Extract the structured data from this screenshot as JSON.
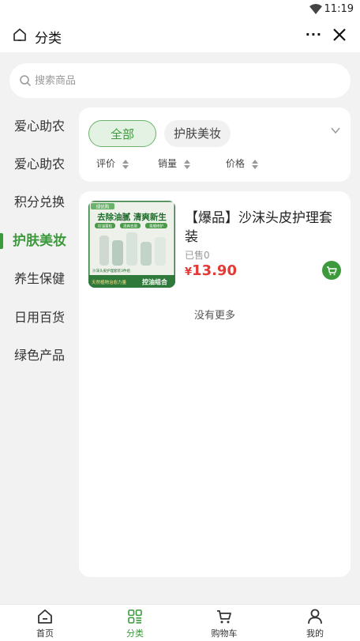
{
  "status_bar": {
    "time": "11:19",
    "wifi_icon": "wifi-icon"
  },
  "nav": {
    "title": "分类",
    "more_label": "···",
    "home_icon": "home-icon",
    "close_icon": "close-icon"
  },
  "search": {
    "placeholder": "搜索商品",
    "value": ""
  },
  "sidebar": {
    "items": [
      {
        "label": "爱心助农",
        "active": false
      },
      {
        "label": "爱心助农",
        "active": false
      },
      {
        "label": "积分兑换",
        "active": false
      },
      {
        "label": "护肤美妆",
        "active": true
      },
      {
        "label": "养生保健",
        "active": false
      },
      {
        "label": "日用百货",
        "active": false
      },
      {
        "label": "绿色产品",
        "active": false
      }
    ]
  },
  "filter": {
    "chips": [
      {
        "label": "全部",
        "active": true
      },
      {
        "label": "护肤美妆",
        "active": false
      }
    ],
    "sort": [
      {
        "label": "评价"
      },
      {
        "label": "销量"
      },
      {
        "label": "价格"
      }
    ]
  },
  "products": [
    {
      "name": "【爆品】沙沫头皮护理套装",
      "sold": "已售0",
      "currency": "¥",
      "price": "13.90",
      "image": {
        "brand": "绿优购",
        "headline": "去除油腻 清爽新生",
        "tags": [
          "控油蓬松",
          "清爽去屑",
          "柔顺修护"
        ],
        "caption": "沙沫头皮护理套装3件组",
        "footer_left": "天然植物治愈力量",
        "footer_right": "控油组合"
      }
    }
  ],
  "list_footer": "没有更多",
  "tabbar": {
    "items": [
      {
        "label": "首页",
        "icon": "home-icon",
        "active": false
      },
      {
        "label": "分类",
        "icon": "category-icon",
        "active": true
      },
      {
        "label": "购物车",
        "icon": "cart-icon",
        "active": false
      },
      {
        "label": "我的",
        "icon": "user-icon",
        "active": false
      }
    ]
  },
  "colors": {
    "accent": "#3c9a3c",
    "price": "#e53935",
    "background": "#f2f2f2"
  }
}
